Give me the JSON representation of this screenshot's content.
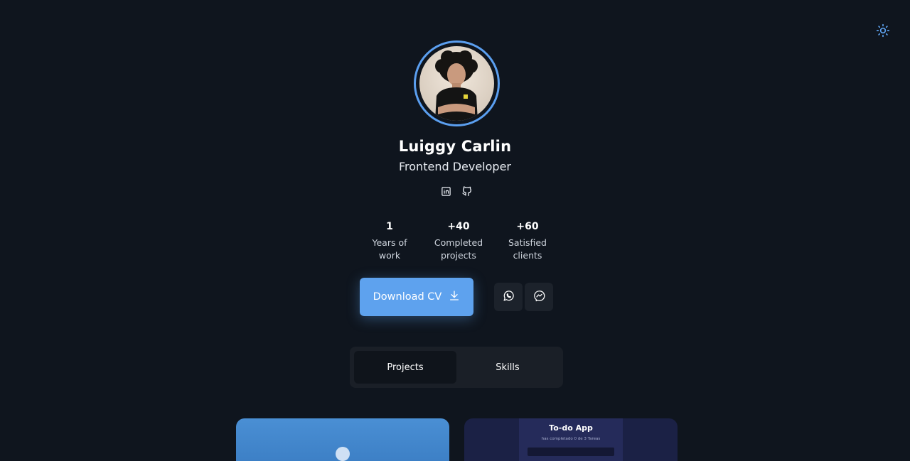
{
  "theme_toggle": {
    "icon": "sun-icon"
  },
  "profile": {
    "name": "Luiggy Carlin",
    "role": "Frontend Developer"
  },
  "socials": [
    {
      "icon": "linkedin-icon"
    },
    {
      "icon": "github-icon"
    }
  ],
  "stats": [
    {
      "value": "1",
      "label_line1": "Years of",
      "label_line2": "work"
    },
    {
      "value": "+40",
      "label_line1": "Completed",
      "label_line2": "projects"
    },
    {
      "value": "+60",
      "label_line1": "Satisfied",
      "label_line2": "clients"
    }
  ],
  "actions": {
    "download_label": "Download CV",
    "download_icon": "download-icon",
    "whatsapp_icon": "whatsapp-icon",
    "messenger_icon": "messenger-icon"
  },
  "tabs": [
    {
      "label": "Projects",
      "active": true
    },
    {
      "label": "Skills",
      "active": false
    }
  ],
  "project_cards": [
    {
      "title": ""
    },
    {
      "title": "To-do App",
      "subtitle": "has completado 0 de 3 Tareas"
    }
  ],
  "colors": {
    "background": "#0f151e",
    "accent": "#5ea2ee",
    "ring": "#5b9ff0"
  }
}
